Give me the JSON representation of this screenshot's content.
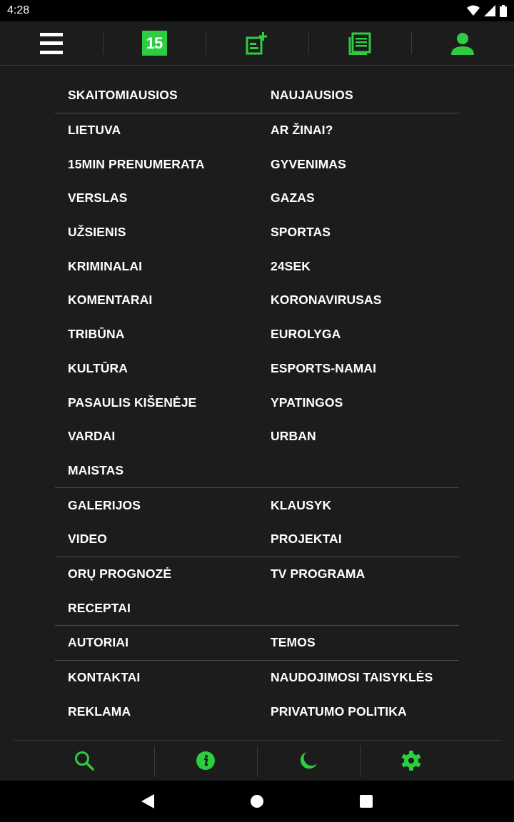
{
  "status_bar": {
    "time": "4:28"
  },
  "topbar": {
    "logo_text": "15",
    "icons": [
      "menu-icon",
      "logo-icon",
      "add-article-icon",
      "articles-icon",
      "user-icon"
    ]
  },
  "menu": {
    "sections": [
      {
        "rows": [
          [
            "SKAITOMIAUSIOS",
            "NAUJAUSIOS"
          ]
        ]
      },
      {
        "rows": [
          [
            "LIETUVA",
            "AR ŽINAI?"
          ],
          [
            "15MIN PRENUMERATA",
            "GYVENIMAS"
          ],
          [
            "VERSLAS",
            "GAZAS"
          ],
          [
            "UŽSIENIS",
            "SPORTAS"
          ],
          [
            "KRIMINALAI",
            "24SEK"
          ],
          [
            "KOMENTARAI",
            "KORONAVIRUSAS"
          ],
          [
            "TRIBŪNA",
            "EUROLYGA"
          ],
          [
            "KULTŪRA",
            "ESPORTS-NAMAI"
          ],
          [
            "PASAULIS KIŠENĖJE",
            "YPATINGOS"
          ],
          [
            "VARDAI",
            "URBAN"
          ],
          [
            "MAISTAS",
            ""
          ]
        ]
      },
      {
        "rows": [
          [
            "GALERIJOS",
            "KLAUSYK"
          ],
          [
            "VIDEO",
            "PROJEKTAI"
          ]
        ]
      },
      {
        "rows": [
          [
            "ORŲ PROGNOZĖ",
            "TV PROGRAMA"
          ],
          [
            "RECEPTAI",
            ""
          ]
        ]
      },
      {
        "rows": [
          [
            "AUTORIAI",
            "TEMOS"
          ]
        ]
      },
      {
        "rows": [
          [
            "KONTAKTAI",
            "NAUDOJIMOSI TAISYKLĖS"
          ],
          [
            "REKLAMA",
            "PRIVATUMO POLITIKA"
          ]
        ]
      }
    ]
  },
  "bottom_toolbar": {
    "icons": [
      "search-icon",
      "info-icon",
      "moon-icon",
      "gear-icon"
    ]
  },
  "colors": {
    "accent": "#2ecc40",
    "background": "#1c1c1c",
    "divider": "#4a4a4a"
  }
}
